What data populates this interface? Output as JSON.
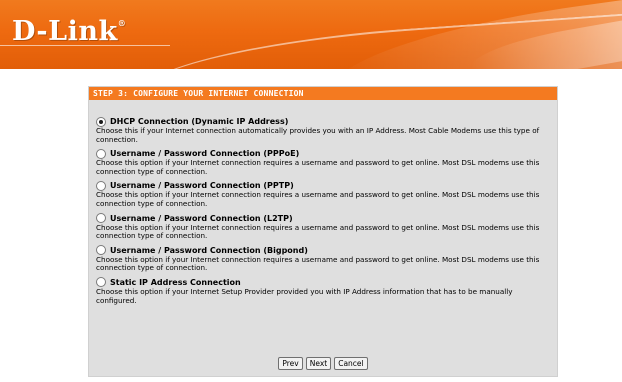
{
  "brand": {
    "logo_text": "D-Link",
    "logo_mark": "®"
  },
  "wizard": {
    "step_title": "STEP 3: CONFIGURE YOUR INTERNET CONNECTION",
    "options": [
      {
        "title": "DHCP Connection (Dynamic IP Address)",
        "description": "Choose this if your Internet connection automatically provides you with an IP Address. Most Cable Modems use this type of connection.",
        "selected": true
      },
      {
        "title": "Username / Password Connection (PPPoE)",
        "description": "Choose this option if your Internet connection requires a username and password to get online. Most DSL modems use this connection type of connection.",
        "selected": false
      },
      {
        "title": "Username / Password Connection (PPTP)",
        "description": "Choose this option if your Internet connection requires a username and password to get online. Most DSL modems use this connection type of connection.",
        "selected": false
      },
      {
        "title": "Username / Password Connection (L2TP)",
        "description": "Choose this option if your Internet connection requires a username and password to get online. Most DSL modems use this connection type of connection.",
        "selected": false
      },
      {
        "title": "Username / Password Connection (Bigpond)",
        "description": "Choose this option if your Internet connection requires a username and password to get online. Most DSL modems use this connection type of connection.",
        "selected": false
      },
      {
        "title": "Static IP Address Connection",
        "description": "Choose this option if your Internet Setup Provider provided you with IP Address information that has to be manually configured.",
        "selected": false
      }
    ],
    "buttons": {
      "prev": "Prev",
      "next": "Next",
      "cancel": "Cancel"
    }
  },
  "colors": {
    "accent": "#f47a20",
    "panel_bg": "#dfdfdf",
    "banner": "#ee6a10"
  }
}
